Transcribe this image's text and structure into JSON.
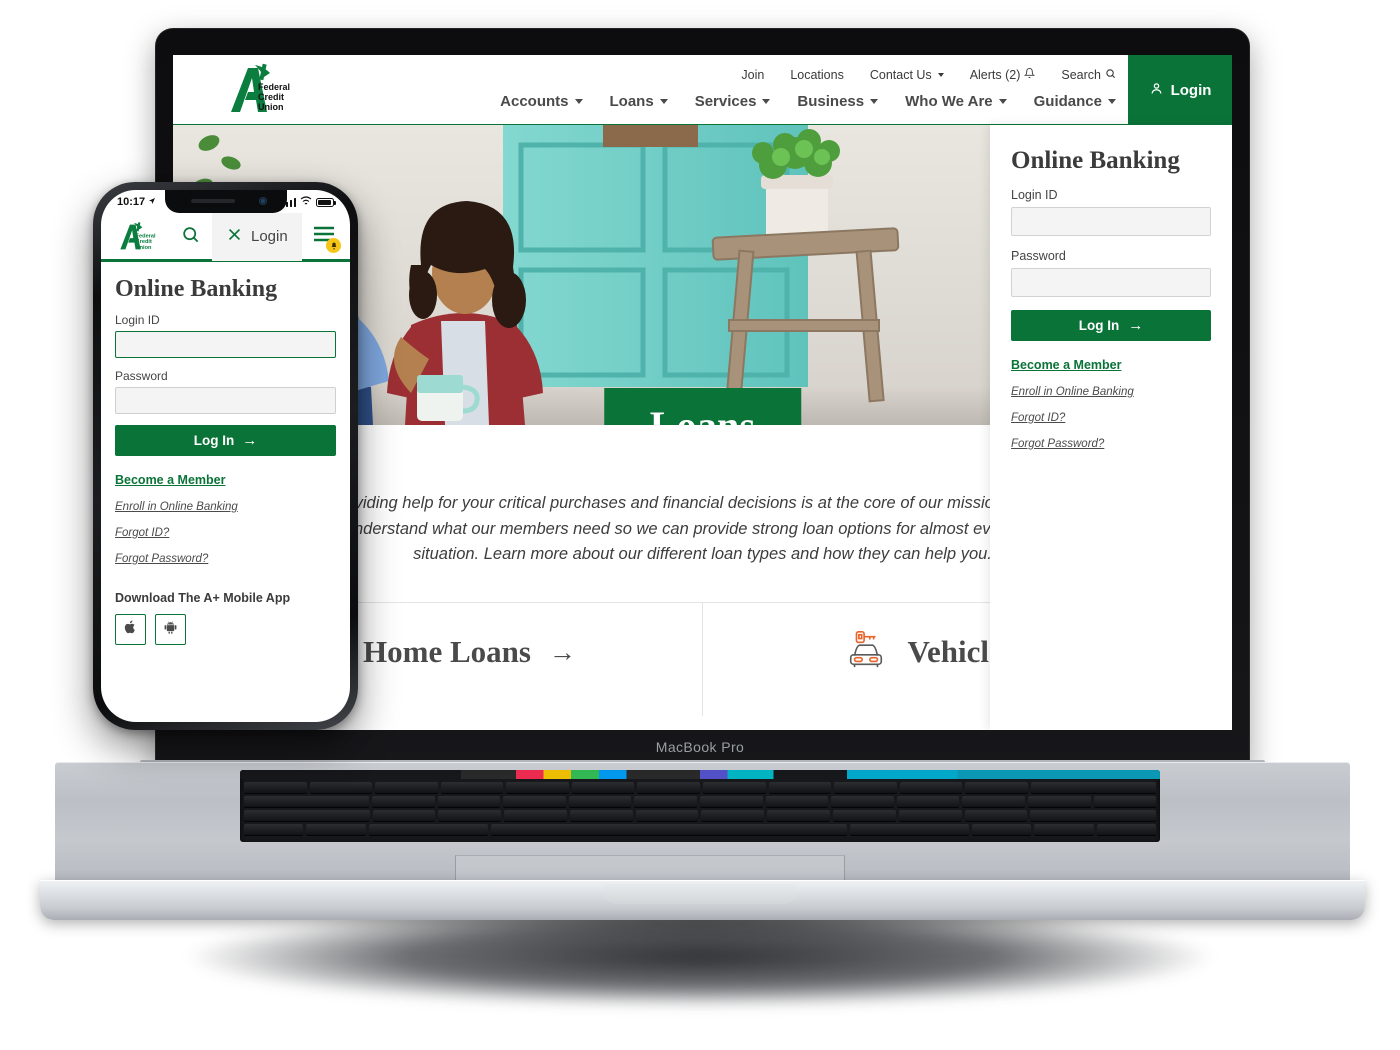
{
  "device": {
    "laptop_label": "MacBook Pro",
    "phone_status": {
      "time": "10:17"
    }
  },
  "site": {
    "logo_alt": "A+ Federal Credit Union",
    "logo_lines": [
      "Federal",
      "Credit",
      "Union"
    ],
    "utility_nav": [
      {
        "label": "Join",
        "has_caret": false,
        "icon": ""
      },
      {
        "label": "Locations",
        "has_caret": false,
        "icon": ""
      },
      {
        "label": "Contact Us",
        "has_caret": true,
        "icon": ""
      },
      {
        "label": "Alerts (2)",
        "has_caret": false,
        "icon": "bell-icon"
      },
      {
        "label": "Search",
        "has_caret": false,
        "icon": "search-icon"
      }
    ],
    "main_nav": [
      {
        "label": "Accounts"
      },
      {
        "label": "Loans"
      },
      {
        "label": "Services"
      },
      {
        "label": "Business"
      },
      {
        "label": "Who We Are"
      },
      {
        "label": "Guidance"
      }
    ],
    "login_button": "Login",
    "hero": {
      "badge": "Loans",
      "intro": "Providing help for your critical purchases and financial decisions is at the core of our mission. We work to understand what our members need so we can provide strong loan options for almost every financial situation. Learn more about our different loan types and how they can help you."
    },
    "cards": [
      {
        "title": "Home Loans",
        "arrow": "→",
        "icon": "house-icon"
      },
      {
        "title": "Vehicle Loans",
        "arrow": "→",
        "icon": "car-key-icon"
      }
    ]
  },
  "online_banking": {
    "title": "Online Banking",
    "login_id_label": "Login ID",
    "login_id_value": "",
    "password_label": "Password",
    "password_value": "",
    "submit_label": "Log In",
    "submit_arrow": "→",
    "links": [
      {
        "label": "Become a Member",
        "style": "bold"
      },
      {
        "label": "Enroll in Online Banking",
        "style": "italic"
      },
      {
        "label": "Forgot ID?",
        "style": "italic"
      },
      {
        "label": "Forgot Password?",
        "style": "italic"
      }
    ]
  },
  "mobile": {
    "header": {
      "login_label": "Login",
      "search_icon": "search-icon",
      "close_icon": "close-icon",
      "menu_icon": "hamburger-icon",
      "badge_icon": "bell-icon"
    },
    "title": "Online Banking",
    "login_id_label": "Login ID",
    "login_id_value": "",
    "password_label": "Password",
    "password_value": "",
    "submit_label": "Log In",
    "submit_arrow": "→",
    "links": [
      {
        "label": "Become a Member",
        "style": "bold"
      },
      {
        "label": "Enroll in Online Banking",
        "style": "italic"
      },
      {
        "label": "Forgot ID?",
        "style": "italic"
      },
      {
        "label": "Forgot Password?",
        "style": "italic"
      }
    ],
    "download_title": "Download The A+ Mobile App",
    "store_buttons": [
      {
        "icon": "apple-icon",
        "name": "apple-app-store-button"
      },
      {
        "icon": "android-icon",
        "name": "google-play-store-button"
      }
    ]
  },
  "colors": {
    "brand_green": "#0a7338",
    "accent_orange": "#e8642a",
    "badge_yellow": "#f5c518",
    "text_gray": "#4a4a4a"
  }
}
